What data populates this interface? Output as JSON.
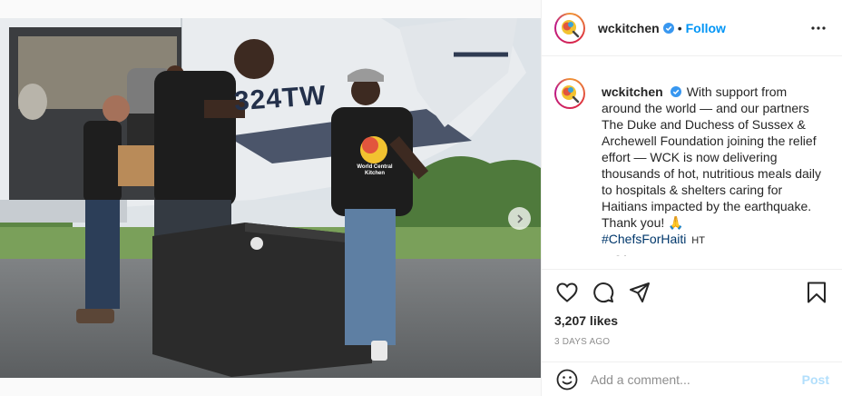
{
  "post": {
    "username": "wckitchen",
    "follow_label": "Follow",
    "follow_separator": "•",
    "caption_text": "With support from around the world — and our partners The Duke and Duchess of Sussex & Archewell Foundation joining the relief effort — WCK is now delivering thousands of hot, nutritious meals daily to hospitals & shelters caring for Haitians impacted by the earthquake. Thank you! 🙏",
    "hashtag": "#ChefsForHaiti",
    "hashtag_suffix": "HT",
    "caption_time": "3d",
    "likes": "3,207 likes",
    "age": "3 DAYS AGO"
  },
  "photo": {
    "plane_registration": "324TW",
    "shirt_text": "World Central Kitchen",
    "carousel_count": 3,
    "carousel_active": 1
  },
  "comment": {
    "placeholder": "Add a comment...",
    "post_label": "Post"
  },
  "icons": {
    "verified": "verified-badge-icon",
    "more": "more-options-icon",
    "like": "heart-icon",
    "comment": "comment-bubble-icon",
    "share": "paper-plane-icon",
    "save": "bookmark-icon",
    "emoji": "smiley-icon",
    "next": "chevron-right-icon"
  },
  "colors": {
    "link": "#0095f6",
    "verified": "#3897f0",
    "post_disabled": "#b2dffc",
    "hashtag": "#00376b"
  }
}
